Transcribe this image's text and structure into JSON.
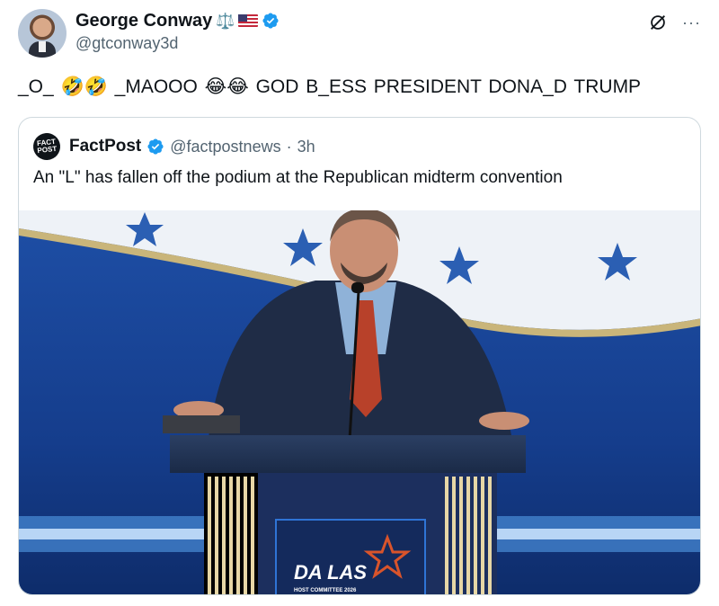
{
  "author": {
    "display_name": "George Conway",
    "name_badge_emoji": "⚖️",
    "handle": "@gtconway3d",
    "avatar_icon": "avatar-photo",
    "verified_color": "#1d9bf0"
  },
  "actions": {
    "grok_icon": "grok-icon",
    "more_label": "···"
  },
  "tweet": {
    "text": "_O_  🤣🤣  _MAOOO  😂😂  GOD B_ESS PRESIDENT DONA_D TRUMP"
  },
  "quoted": {
    "logo_line1": "FACT",
    "logo_line2": "POST",
    "display_name": "FactPost",
    "handle": "@factpostnews",
    "separator": "·",
    "time": "3h",
    "text": "An \"L\" has fallen off the podium at the Republican midterm convention",
    "media": {
      "podium_sign_main": "DA  LAS",
      "podium_sign_sub": "HOST COMMITTEE 2026"
    }
  }
}
